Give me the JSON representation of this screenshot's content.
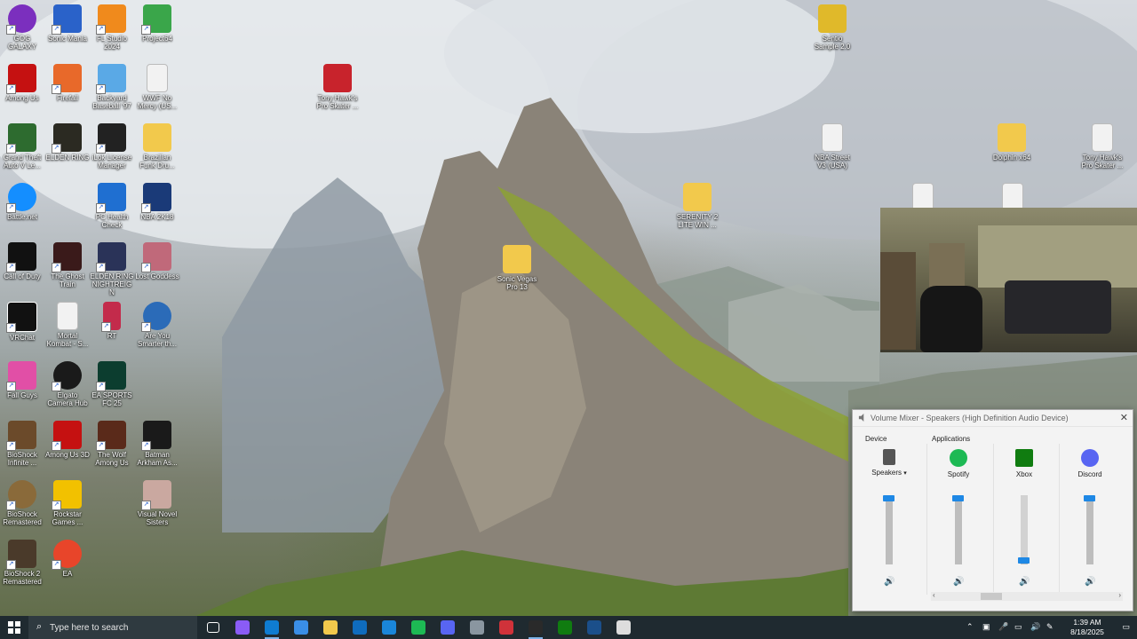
{
  "desktop_icons": [
    {
      "label": "GOG GALAXY",
      "color": "#7b2fbe"
    },
    {
      "label": "Sonic Mania",
      "color": "#2a62c9"
    },
    {
      "label": "FL Studio 2024",
      "color": "#f08a1c"
    },
    {
      "label": "Project64",
      "color": "#3aa64a"
    },
    {
      "label": "Among Us",
      "color": "#c51111"
    },
    {
      "label": "Firefall",
      "color": "#e8692a"
    },
    {
      "label": "Backyard Baseball '97",
      "color": "#5aa9e6"
    },
    {
      "label": "WWF No Mercy (US...",
      "color": "#f2f2f2"
    },
    {
      "label": "Grand Theft Auto V Le...",
      "color": "#2d6b2f"
    },
    {
      "label": "ELDEN RING",
      "color": "#2b2a22"
    },
    {
      "label": "iLok License Manager",
      "color": "#222222"
    },
    {
      "label": "Brazilian Funk Dru...",
      "color": "#f2c94c"
    },
    {
      "label": "Battle.net",
      "color": "#148eff"
    },
    {
      "label": "PC Health Check",
      "color": "#1f6fd1"
    },
    {
      "label": "NBA 2K18",
      "color": "#1a3a78"
    },
    {
      "label": "Call of Duty",
      "color": "#111111"
    },
    {
      "label": "The Ghost Train",
      "color": "#3a1a1a"
    },
    {
      "label": "ELDEN RING NIGHTREIGN",
      "color": "#2a3358"
    },
    {
      "label": "Lost Goddess",
      "color": "#c0697a"
    },
    {
      "label": "VRChat",
      "color": "#111111"
    },
    {
      "label": "Mortal Kombat - S...",
      "color": "#f2f2f2"
    },
    {
      "label": "RT",
      "color": "#c32b4b"
    },
    {
      "label": "Are You Smarter th...",
      "color": "#2b6bb8"
    },
    {
      "label": "Fall Guys",
      "color": "#e14fa6"
    },
    {
      "label": "Elgato Camera Hub",
      "color": "#1a1a1a"
    },
    {
      "label": "EA SPORTS FC 25",
      "color": "#0c3d2f"
    },
    {
      "label": "BioShock Infinite ...",
      "color": "#6b4a2a"
    },
    {
      "label": "Among Us 3D",
      "color": "#c51111"
    },
    {
      "label": "The Wolf Among Us",
      "color": "#5a2a1a"
    },
    {
      "label": "Batman Arkham As...",
      "color": "#1a1a1a"
    },
    {
      "label": "BioShock Remastered",
      "color": "#8a6a3a"
    },
    {
      "label": "Rockstar Games ...",
      "color": "#f2c100"
    },
    {
      "label": "Visual Novel Sisters",
      "color": "#caa8a0"
    },
    {
      "label": "BioShock 2 Remastered",
      "color": "#4a3a2a"
    },
    {
      "label": "EA",
      "color": "#e8452a"
    }
  ],
  "floating_icons": [
    {
      "label": "Tony Hawk's Pro Skater ...",
      "color": "#c8232c"
    },
    {
      "label": "Sonic Vegas Pro 13",
      "color": "#f2c94c"
    },
    {
      "label": "Sentio Sample 2.0",
      "color": "#e0b92a"
    },
    {
      "label": "NBA Street V3 (USA)",
      "color": "#f2f2f2"
    },
    {
      "label": "SERENITY 2 LITE WIN ...",
      "color": "#f2c94c"
    },
    {
      "label": "Dolphin x64",
      "color": "#f2c94c"
    },
    {
      "label": "Tony Hawk's Pro Skater ...",
      "color": "#f2f2f2"
    }
  ],
  "volume_mixer": {
    "title": "Volume Mixer - Speakers (High Definition Audio Device)",
    "close": "✕",
    "device_label": "Device",
    "applications_label": "Applications",
    "device": {
      "name": "Speakers",
      "level": 1.0
    },
    "apps": [
      {
        "name": "Spotify",
        "level": 1.0,
        "color": "#1db954"
      },
      {
        "name": "Xbox",
        "level": 0.02,
        "color": "#107c10"
      },
      {
        "name": "Discord",
        "level": 1.0,
        "color": "#5865f2"
      }
    ]
  },
  "taskbar": {
    "search_placeholder": "Type here to search",
    "time": "1:39 AM",
    "date": "8/18/2025",
    "pinned": [
      {
        "name": "task-view",
        "color": "#ffffff"
      },
      {
        "name": "copilot",
        "color": "#8a5cf6"
      },
      {
        "name": "edge",
        "color": "#0f7cd1"
      },
      {
        "name": "store",
        "color": "#3a8ee6"
      },
      {
        "name": "file-explorer",
        "color": "#f2c94c"
      },
      {
        "name": "outlook",
        "color": "#0f6cbd"
      },
      {
        "name": "photos",
        "color": "#1a86d9"
      },
      {
        "name": "spotify",
        "color": "#1db954"
      },
      {
        "name": "discord",
        "color": "#5865f2"
      },
      {
        "name": "app-generic",
        "color": "#8a96a0"
      },
      {
        "name": "app-red",
        "color": "#d0323a"
      },
      {
        "name": "epic-games",
        "color": "#2a2a2a"
      },
      {
        "name": "xbox",
        "color": "#107c10"
      },
      {
        "name": "steam",
        "color": "#1b4f8a"
      },
      {
        "name": "app-white",
        "color": "#dddddd"
      }
    ]
  }
}
